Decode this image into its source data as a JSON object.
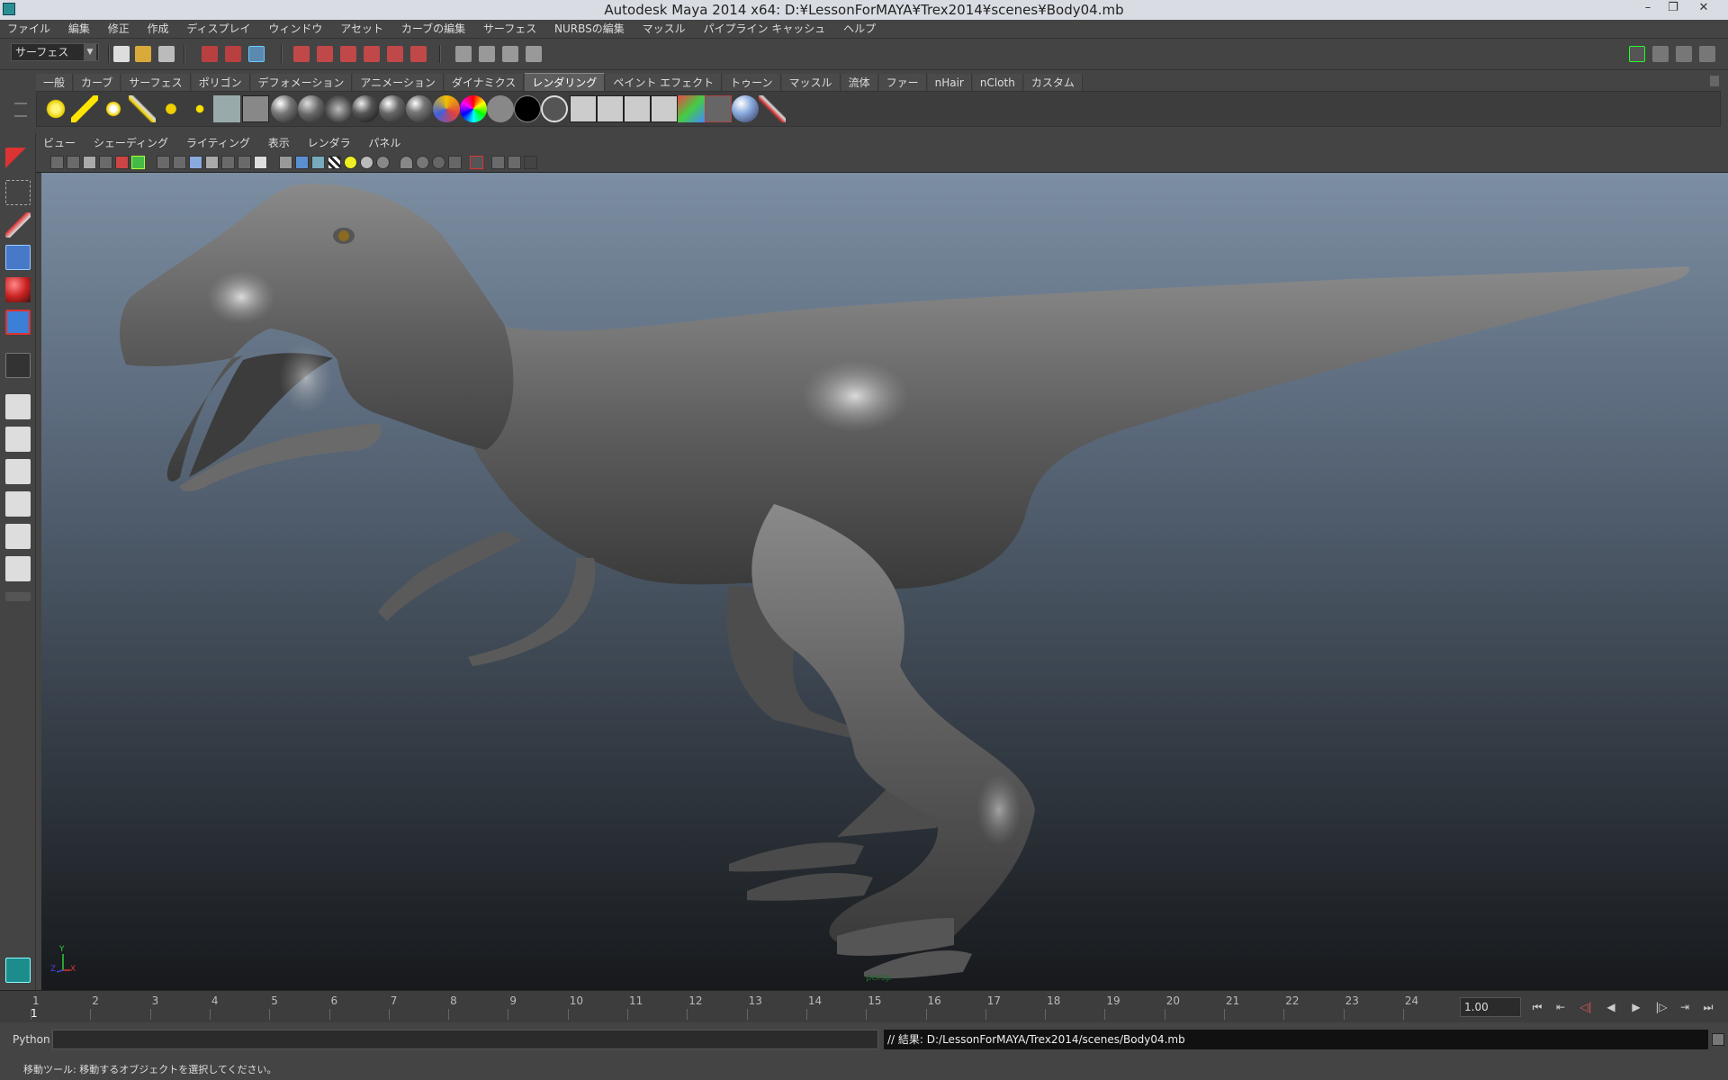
{
  "window": {
    "title": "Autodesk Maya 2014 x64: D:¥LessonForMAYA¥Trex2014¥scenes¥Body04.mb",
    "controls": [
      "–",
      "❐",
      "✕"
    ]
  },
  "menubar": [
    "ファイル",
    "編集",
    "修正",
    "作成",
    "ディスプレイ",
    "ウィンドウ",
    "アセット",
    "カーブの編集",
    "サーフェス",
    "NURBSの編集",
    "マッスル",
    "パイプライン キャッシュ",
    "ヘルプ"
  ],
  "statusline": {
    "mode": "サーフェス"
  },
  "shelf": {
    "tabs": [
      "一般",
      "カーブ",
      "サーフェス",
      "ポリゴン",
      "デフォメーション",
      "アニメーション",
      "ダイナミクス",
      "レンダリング",
      "ペイント エフェクト",
      "トゥーン",
      "マッスル",
      "流体",
      "ファー",
      "nHair",
      "nCloth",
      "カスタム"
    ],
    "active_tab": "レンダリング"
  },
  "panel": {
    "menu": [
      "ビュー",
      "シェーディング",
      "ライティング",
      "表示",
      "レンダラ",
      "パネル"
    ],
    "camera": "persp",
    "axis": {
      "y": "Y",
      "z": "Z",
      "x": "X"
    }
  },
  "timeslider": {
    "ticks": [
      "1",
      "2",
      "3",
      "4",
      "5",
      "6",
      "7",
      "8",
      "9",
      "10",
      "11",
      "12",
      "13",
      "14",
      "15",
      "16",
      "17",
      "18",
      "19",
      "20",
      "21",
      "22",
      "23",
      "24"
    ],
    "current_frame": "1",
    "playback_value": "1.00"
  },
  "cmdline": {
    "language": "Python",
    "result": "// 結果: D:/LessonForMAYA/Trex2014/scenes/Body04.mb"
  },
  "helpline": {
    "text": "移動ツール: 移動するオブジェクトを選択してください。"
  }
}
